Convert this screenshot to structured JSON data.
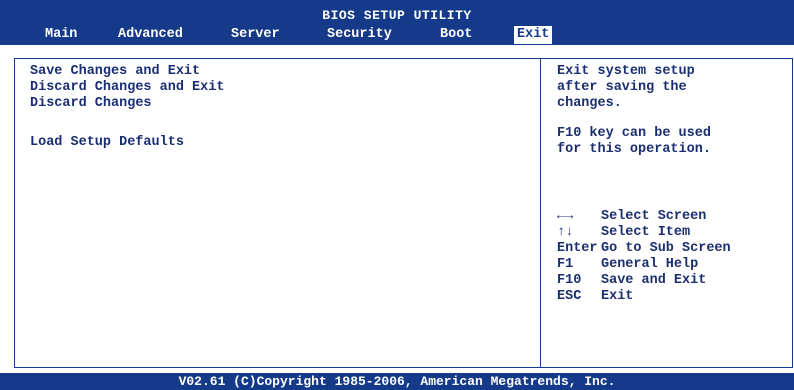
{
  "header": {
    "title": "BIOS SETUP UTILITY",
    "tabs": [
      {
        "label": "Main"
      },
      {
        "label": "Advanced"
      },
      {
        "label": "Server"
      },
      {
        "label": "Security"
      },
      {
        "label": "Boot"
      },
      {
        "label": "Exit",
        "active": true
      }
    ]
  },
  "menu": {
    "items": [
      {
        "label": "Save Changes and Exit"
      },
      {
        "label": "Discard Changes and Exit"
      },
      {
        "label": "Discard Changes"
      },
      {
        "label": "Load Setup Defaults"
      }
    ]
  },
  "help": {
    "lines": [
      "Exit system setup",
      "after saving the",
      "changes.",
      "F10 key can be used",
      "for this operation."
    ]
  },
  "keys": [
    {
      "key": "←→",
      "action": "Select Screen"
    },
    {
      "key": "↑↓",
      "action": "Select Item"
    },
    {
      "key": "Enter",
      "action": "Go to Sub Screen"
    },
    {
      "key": "F1",
      "action": "General Help"
    },
    {
      "key": "F10",
      "action": "Save and Exit"
    },
    {
      "key": "ESC",
      "action": "Exit"
    }
  ],
  "footer": {
    "text": "V02.61 (C)Copyright 1985-2006, American Megatrends, Inc."
  },
  "colors": {
    "bar": "#163a8a",
    "text": "#1a2e70",
    "background": "#ffffff"
  }
}
